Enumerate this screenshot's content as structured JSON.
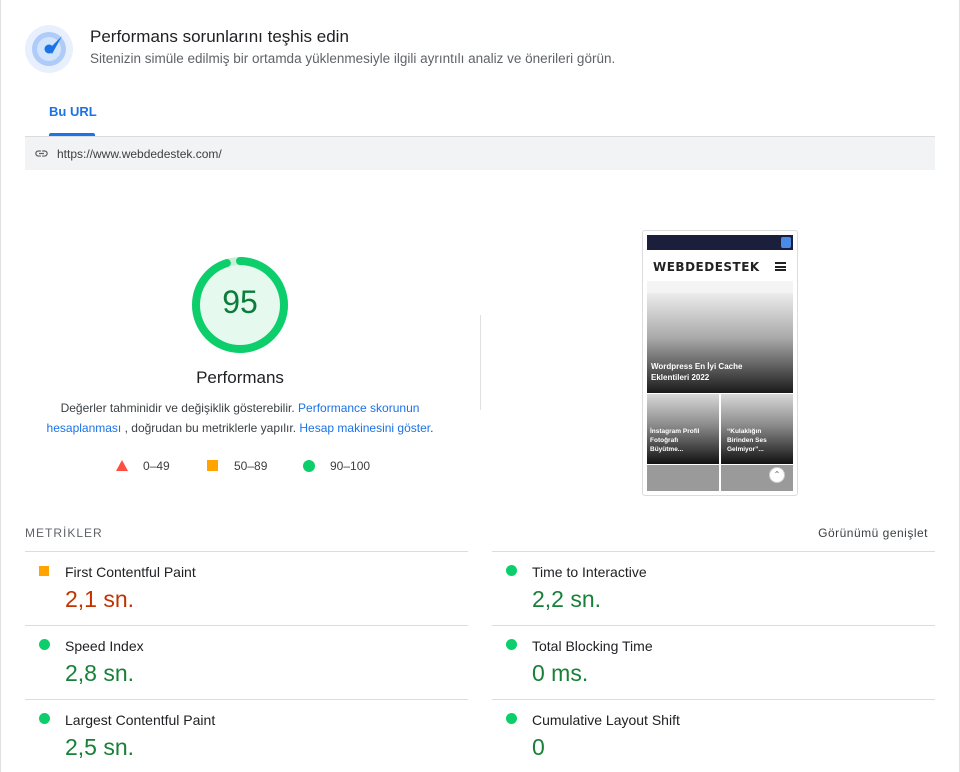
{
  "header": {
    "title": "Performans sorunlarını teşhis edin",
    "subtitle": "Sitenizin simüle edilmiş bir ortamda yüklenmesiyle ilgili ayrıntılı analiz ve önerileri görün."
  },
  "tabs": [
    {
      "label": "Bu URL",
      "active": true
    }
  ],
  "url": "https://www.webdedestek.com/",
  "score": {
    "value": "95",
    "fraction": 0.95,
    "label": "Performans",
    "color": "#0cce6b",
    "description_1": "Değerler tahminidir ve değişiklik gösterebilir.",
    "link_1": "Performance skorunun hesaplanması",
    "description_2": ", doğrudan bu metriklerle yapılır.",
    "link_2": "Hesap makinesini göster",
    "description_3": "."
  },
  "legend": [
    {
      "label": "0–49",
      "shape": "triangle",
      "color": "#ff4e42"
    },
    {
      "label": "50–89",
      "shape": "square",
      "color": "#ffa400"
    },
    {
      "label": "90–100",
      "shape": "circle",
      "color": "#0cce6b"
    }
  ],
  "thumbnail": {
    "logo": "WEBDEDESTEK",
    "hero_title": "Wordpress En İyi Cache Eklentileri 2022",
    "card_1": "İnstagram Profil Fotoğrafı Büyütme...",
    "card_2": "“Kulaklığın Birinden Ses Gelmiyor”..."
  },
  "metrics_section": {
    "title": "METRİKLER",
    "expand_label": "Görünümü genişlet"
  },
  "metrics": [
    {
      "name": "First Contentful Paint",
      "value": "2,1 sn.",
      "status": "average",
      "icon": "square-icon"
    },
    {
      "name": "Time to Interactive",
      "value": "2,2 sn.",
      "status": "good",
      "icon": "circle-icon"
    },
    {
      "name": "Speed Index",
      "value": "2,8 sn.",
      "status": "good",
      "icon": "circle-icon"
    },
    {
      "name": "Total Blocking Time",
      "value": "0 ms.",
      "status": "good",
      "icon": "circle-icon"
    },
    {
      "name": "Largest Contentful Paint",
      "value": "2,5 sn.",
      "status": "good",
      "icon": "circle-icon"
    },
    {
      "name": "Cumulative Layout Shift",
      "value": "0",
      "status": "good",
      "icon": "circle-icon"
    }
  ]
}
